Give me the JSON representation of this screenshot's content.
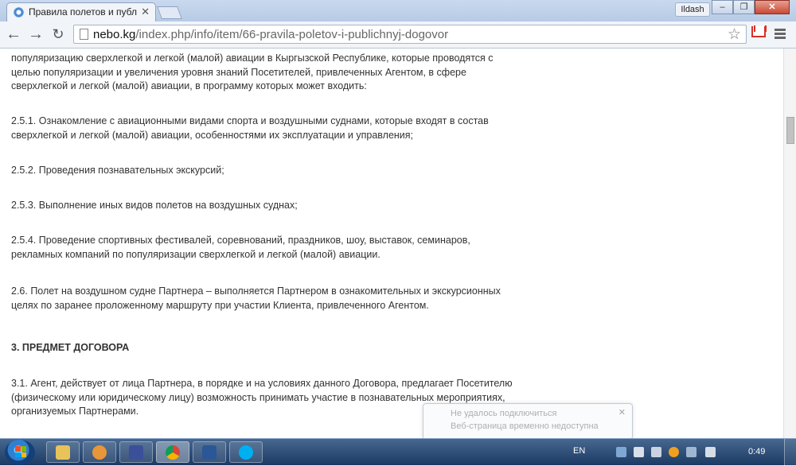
{
  "browser": {
    "tab_title": "Правила полетов и публ",
    "user_badge": "Ildash",
    "url_host": "nebo.kg",
    "url_path": "/index.php/info/item/66-pravila-poletov-i-publichnyj-dogovor"
  },
  "document": {
    "paragraphs": [
      "популяризацию сверхлегкой и легкой (малой) авиации в Кыргызской Республике, которые проводятся с целью популяризации и увеличения уровня знаний Посетителей, привлеченных Агентом, в сфере сверхлегкой и легкой (малой) авиации, в программу которых может входить:",
      "2.5.1. Ознакомление с авиационными видами спорта и воздушными суднами, которые входят в состав сверхлегкой и легкой (малой) авиации, особенностями их эксплуатации и управления;",
      "2.5.2. Проведения познавательных экскурсий;",
      "2.5.3. Выполнение иных видов полетов на воздушных суднах;",
      "2.5.4. Проведение спортивных фестивалей, соревнований, праздников, шоу, выставок, семинаров, рекламных компаний по популяризации сверхлегкой и легкой (малой) авиации.",
      "2.6. Полет на воздушном судне Партнера – выполняется Партнером в ознакомительных и экскурсионных целях по заранее проложенному маршруту при участии Клиента, привлеченного Агентом.",
      "3. ПРЕДМЕТ ДОГОВОРА",
      "3.1. Агент, действует от лица Партнера, в порядке и на условиях данного Договора, предлагает Посетителю (физическому или юридическому лицу) возможность принимать участие в познавательных мероприятиях, организуемых Партнерами."
    ]
  },
  "notification": {
    "title": "Не удалось подключиться",
    "text": "Веб-страница временно недоступна"
  },
  "taskbar": {
    "language": "EN",
    "clock": "0:49"
  },
  "colors": {
    "text": "#333333",
    "accent": "#d93025",
    "taskbar": "#1c3a63"
  }
}
